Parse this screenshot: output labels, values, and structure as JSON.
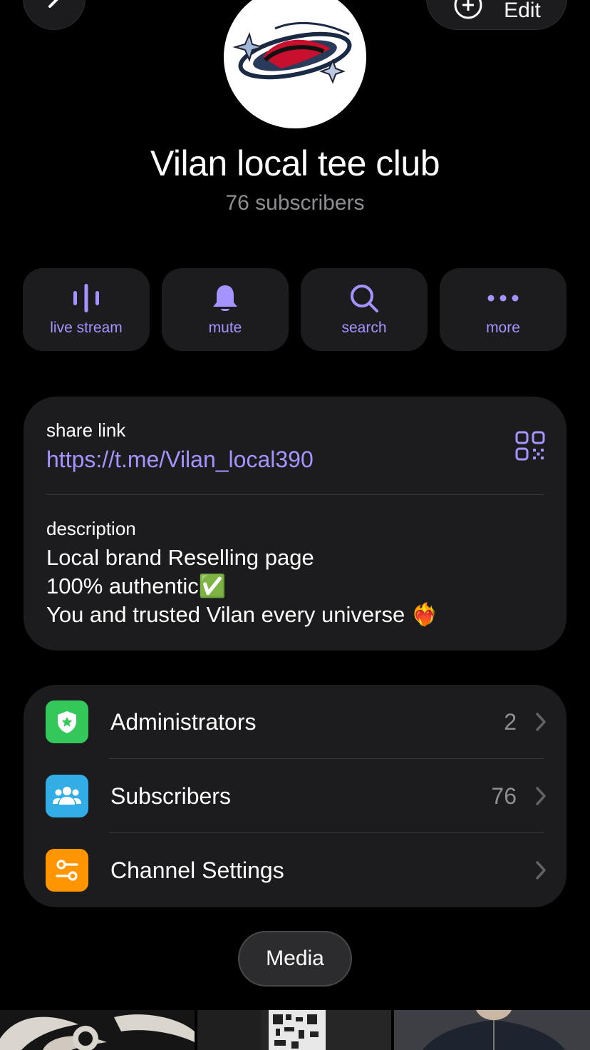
{
  "header": {
    "edit_label": "Edit"
  },
  "channel": {
    "title": "Vilan local tee club",
    "subtitle": "76 subscribers"
  },
  "actions": [
    {
      "label": "live stream",
      "icon": "live-stream-icon"
    },
    {
      "label": "mute",
      "icon": "bell-icon"
    },
    {
      "label": "search",
      "icon": "search-icon"
    },
    {
      "label": "more",
      "icon": "more-dots-icon"
    }
  ],
  "info": {
    "share_label": "share link",
    "share_url": "https://t.me/Vilan_local390",
    "description_label": "description",
    "description_lines": [
      "Local brand Reselling page",
      "100% authentic✅",
      "You and trusted Vilan every universe ❤️‍🔥"
    ]
  },
  "menu": [
    {
      "label": "Administrators",
      "value": "2",
      "icon": "shield-star-icon",
      "color": "#34c759"
    },
    {
      "label": "Subscribers",
      "value": "76",
      "icon": "people-icon",
      "color": "#32ade6"
    },
    {
      "label": "Channel Settings",
      "value": "",
      "icon": "sliders-icon",
      "color": "#ff9500"
    }
  ],
  "media_tab": "Media",
  "colors": {
    "accent": "#a594ff",
    "card": "#1c1c1e",
    "background": "#000000"
  }
}
